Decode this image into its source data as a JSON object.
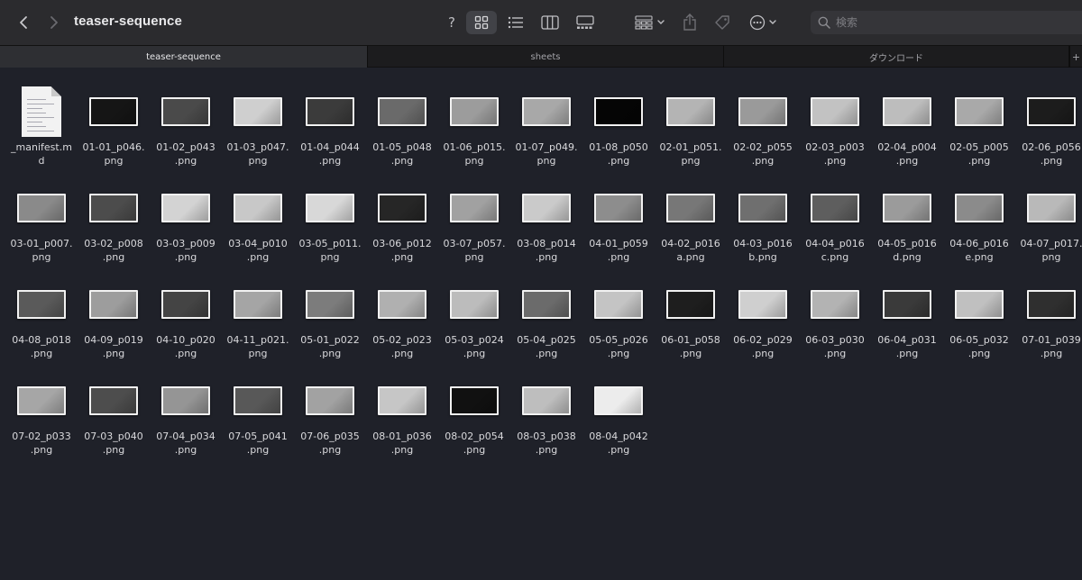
{
  "window": {
    "title": "teaser-sequence"
  },
  "toolbar": {
    "back_icon": "chevron-left-icon",
    "forward_icon": "chevron-right-icon",
    "help_label": "?",
    "icons": [
      "help-icon",
      "icon-view-icon",
      "list-view-icon",
      "column-view-icon",
      "gallery-view-icon",
      "group-by-icon",
      "share-icon",
      "tag-icon",
      "more-actions-icon"
    ],
    "search_placeholder": "検索"
  },
  "tabs": [
    {
      "label": "teaser-sequence",
      "active": true
    },
    {
      "label": "sheets",
      "active": false
    },
    {
      "label": "ダウンロード",
      "active": false
    }
  ],
  "add_tab_label": "+",
  "files": [
    {
      "name": "_manifest.m\nd",
      "kind": "markdown"
    },
    {
      "name": "01-01_p046.\npng",
      "kind": "image",
      "tone": "#151515"
    },
    {
      "name": "01-02_p043\n.png",
      "kind": "image",
      "tone": "#4a4a4a"
    },
    {
      "name": "01-03_p047.\npng",
      "kind": "image",
      "tone": "#cfcfcf"
    },
    {
      "name": "01-04_p044\n.png",
      "kind": "image",
      "tone": "#3b3b3b"
    },
    {
      "name": "01-05_p048\n.png",
      "kind": "image",
      "tone": "#6a6a6a"
    },
    {
      "name": "01-06_p015.\npng",
      "kind": "image",
      "tone": "#9c9c9c"
    },
    {
      "name": "01-07_p049.\npng",
      "kind": "image",
      "tone": "#a8a8a8"
    },
    {
      "name": "01-08_p050\n.png",
      "kind": "image",
      "tone": "#050505"
    },
    {
      "name": "02-01_p051.\npng",
      "kind": "image",
      "tone": "#b4b4b4"
    },
    {
      "name": "02-02_p055\n.png",
      "kind": "image",
      "tone": "#9a9a9a"
    },
    {
      "name": "02-03_p003\n.png",
      "kind": "image",
      "tone": "#c2c2c2"
    },
    {
      "name": "02-04_p004\n.png",
      "kind": "image",
      "tone": "#bdbdbd"
    },
    {
      "name": "02-05_p005\n.png",
      "kind": "image",
      "tone": "#a9a9a9"
    },
    {
      "name": "02-06_p056\n.png",
      "kind": "image",
      "tone": "#1c1c1c"
    },
    {
      "name": "03-01_p007.\npng",
      "kind": "image",
      "tone": "#8a8a8a"
    },
    {
      "name": "03-02_p008\n.png",
      "kind": "image",
      "tone": "#4c4c4c"
    },
    {
      "name": "03-03_p009\n.png",
      "kind": "image",
      "tone": "#d3d3d3"
    },
    {
      "name": "03-04_p010\n.png",
      "kind": "image",
      "tone": "#c8c8c8"
    },
    {
      "name": "03-05_p011.\npng",
      "kind": "image",
      "tone": "#d8d8d8"
    },
    {
      "name": "03-06_p012\n.png",
      "kind": "image",
      "tone": "#262626"
    },
    {
      "name": "03-07_p057.\npng",
      "kind": "image",
      "tone": "#a1a1a1"
    },
    {
      "name": "03-08_p014\n.png",
      "kind": "image",
      "tone": "#cacaca"
    },
    {
      "name": "04-01_p059\n.png",
      "kind": "image",
      "tone": "#8d8d8d"
    },
    {
      "name": "04-02_p016\na.png",
      "kind": "image",
      "tone": "#777777"
    },
    {
      "name": "04-03_p016\nb.png",
      "kind": "image",
      "tone": "#6f6f6f"
    },
    {
      "name": "04-04_p016\nc.png",
      "kind": "image",
      "tone": "#5e5e5e"
    },
    {
      "name": "04-05_p016\nd.png",
      "kind": "image",
      "tone": "#9b9b9b"
    },
    {
      "name": "04-06_p016\ne.png",
      "kind": "image",
      "tone": "#8b8b8b"
    },
    {
      "name": "04-07_p017.\npng",
      "kind": "image",
      "tone": "#b9b9b9"
    },
    {
      "name": "04-08_p018\n.png",
      "kind": "image",
      "tone": "#5a5a5a"
    },
    {
      "name": "04-09_p019\n.png",
      "kind": "image",
      "tone": "#9d9d9d"
    },
    {
      "name": "04-10_p020\n.png",
      "kind": "image",
      "tone": "#444444"
    },
    {
      "name": "04-11_p021.\npng",
      "kind": "image",
      "tone": "#a5a5a5"
    },
    {
      "name": "05-01_p022\n.png",
      "kind": "image",
      "tone": "#7c7c7c"
    },
    {
      "name": "05-02_p023\n.png",
      "kind": "image",
      "tone": "#b0b0b0"
    },
    {
      "name": "05-03_p024\n.png",
      "kind": "image",
      "tone": "#bcbcbc"
    },
    {
      "name": "05-04_p025\n.png",
      "kind": "image",
      "tone": "#6b6b6b"
    },
    {
      "name": "05-05_p026\n.png",
      "kind": "image",
      "tone": "#c4c4c4"
    },
    {
      "name": "06-01_p058\n.png",
      "kind": "image",
      "tone": "#1e1e1e"
    },
    {
      "name": "06-02_p029\n.png",
      "kind": "image",
      "tone": "#cfcfcf"
    },
    {
      "name": "06-03_p030\n.png",
      "kind": "image",
      "tone": "#b3b3b3"
    },
    {
      "name": "06-04_p031\n.png",
      "kind": "image",
      "tone": "#3a3a3a"
    },
    {
      "name": "06-05_p032\n.png",
      "kind": "image",
      "tone": "#c0c0c0"
    },
    {
      "name": "07-01_p039\n.png",
      "kind": "image",
      "tone": "#2f2f2f"
    },
    {
      "name": "07-02_p033\n.png",
      "kind": "image",
      "tone": "#a6a6a6"
    },
    {
      "name": "07-03_p040\n.png",
      "kind": "image",
      "tone": "#4d4d4d"
    },
    {
      "name": "07-04_p034\n.png",
      "kind": "image",
      "tone": "#959595"
    },
    {
      "name": "07-05_p041\n.png",
      "kind": "image",
      "tone": "#585858"
    },
    {
      "name": "07-06_p035\n.png",
      "kind": "image",
      "tone": "#a2a2a2"
    },
    {
      "name": "08-01_p036\n.png",
      "kind": "image",
      "tone": "#c6c6c6"
    },
    {
      "name": "08-02_p054\n.png",
      "kind": "image",
      "tone": "#111111"
    },
    {
      "name": "08-03_p038\n.png",
      "kind": "image",
      "tone": "#bebebe"
    },
    {
      "name": "08-04_p042\n.png",
      "kind": "image",
      "tone": "#ececec"
    }
  ],
  "colors": {
    "window_background": "#1f2129",
    "toolbar_background": "#2b2b2e",
    "active_tab": "#2e2f33",
    "thumbnail_border": "#f2f2f2"
  }
}
